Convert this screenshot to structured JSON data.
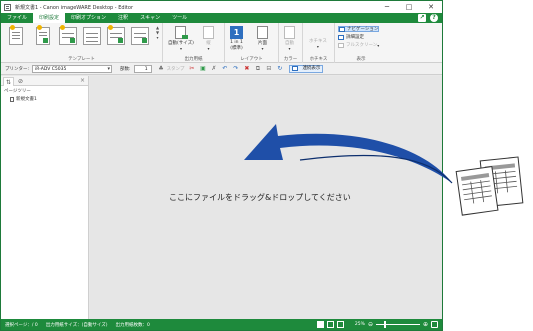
{
  "window": {
    "title": "新規文書1 - Canon imageWARE Desktop - Editor",
    "controls": {
      "minimize": "─",
      "maximize": "□",
      "close": "✕"
    }
  },
  "menubar": {
    "items": [
      {
        "label": "ファイル",
        "active": false
      },
      {
        "label": "印刷設定",
        "active": true
      },
      {
        "label": "印刷オプション",
        "active": false
      },
      {
        "label": "注釈",
        "active": false
      },
      {
        "label": "スキャン",
        "active": false
      },
      {
        "label": "ツール",
        "active": false
      }
    ],
    "right_icons": [
      "export-icon",
      "help-icon"
    ]
  },
  "ribbon": {
    "template_group_label": "テンプレート",
    "output_group": {
      "label": "出力用紙",
      "auto_size": "自動(サイズ)",
      "orientation": "縦"
    },
    "layout_group": {
      "label": "レイアウト",
      "n_in_1": "1 in 1",
      "n_in_1_sub": "(標準)",
      "n_in_1_icon": "1",
      "duplex": "片面"
    },
    "color_group": {
      "label": "カラー",
      "auto": "自動"
    },
    "stapling_group": {
      "label": "ホチキス",
      "button": "ホチキス"
    },
    "display_group": {
      "label": "表示",
      "items": [
        {
          "label": "ナビゲーション",
          "selected": true,
          "disabled": false
        },
        {
          "label": "詳細設定",
          "selected": false,
          "disabled": false
        },
        {
          "label": "フルスクリーン",
          "selected": false,
          "disabled": true
        }
      ]
    }
  },
  "toolbar": {
    "printer_label": "プリンター:",
    "printer_value": "iR-ADV C5035",
    "copies_label": "部数:",
    "copies_value": "1",
    "stamp_label": "スタンプ",
    "continuous_label": "連続表示"
  },
  "leftpane": {
    "title": "ページツリー",
    "tree_item": "新規文書1"
  },
  "main": {
    "drop_text": "ここにファイルをドラッグ&ドロップしてください"
  },
  "statusbar": {
    "selected_page": "選択ページ：/ 0",
    "output_size": "出力用紙サイズ：(自動サイズ)",
    "output_pages": "出力用紙枚数：0",
    "zoom": "25%",
    "zoom_level": 0.18
  },
  "colors": {
    "accent": "#1e8a3c",
    "arrow": "#1f4fa8",
    "selection": "#cfe3fb"
  }
}
